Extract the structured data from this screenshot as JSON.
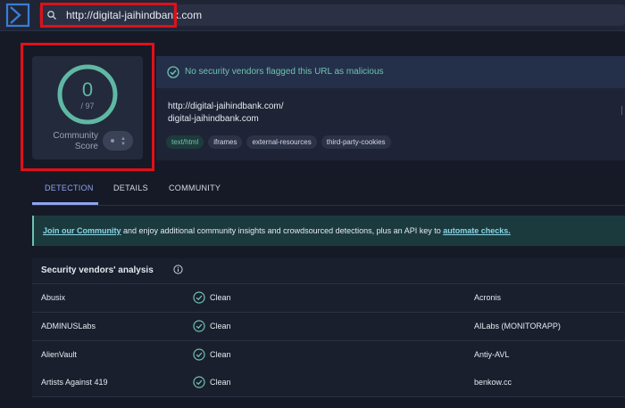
{
  "colors": {
    "accent": "#5fb8a4",
    "red_highlight": "#e0101a",
    "tab_active": "#8fa4ee",
    "link": "#8ad6e6"
  },
  "search": {
    "value": "http://digital-jaihindbank.com"
  },
  "score": {
    "value": "0",
    "total": "/ 97",
    "community_label_1": "Community",
    "community_label_2": "Score"
  },
  "summary": {
    "banner": "No security vendors flagged this URL as malicious",
    "url": "http://digital-jaihindbank.com/",
    "host": "digital-jaihindbank.com",
    "tags": [
      "text/html",
      "iframes",
      "external-resources",
      "third-party-cookies"
    ]
  },
  "tabs": [
    {
      "label": "DETECTION"
    },
    {
      "label": "DETAILS"
    },
    {
      "label": "COMMUNITY"
    }
  ],
  "community": {
    "link1": "Join our Community",
    "text": " and enjoy additional community insights and crowdsourced detections, plus an API key to ",
    "link2": "automate checks."
  },
  "vendors": {
    "title": "Security vendors' analysis",
    "rows": [
      {
        "vendor": "Abusix",
        "status": "Clean",
        "vendor2": "Acronis"
      },
      {
        "vendor": "ADMINUSLabs",
        "status": "Clean",
        "vendor2": "AILabs (MONITORAPP)"
      },
      {
        "vendor": "AlienVault",
        "status": "Clean",
        "vendor2": "Antiy-AVL"
      },
      {
        "vendor": "Artists Against 419",
        "status": "Clean",
        "vendor2": "benkow.cc"
      }
    ]
  },
  "icons": [
    "virustotal-logo-icon",
    "search-icon",
    "check-circle-icon",
    "info-icon",
    "cursor-icon"
  ]
}
